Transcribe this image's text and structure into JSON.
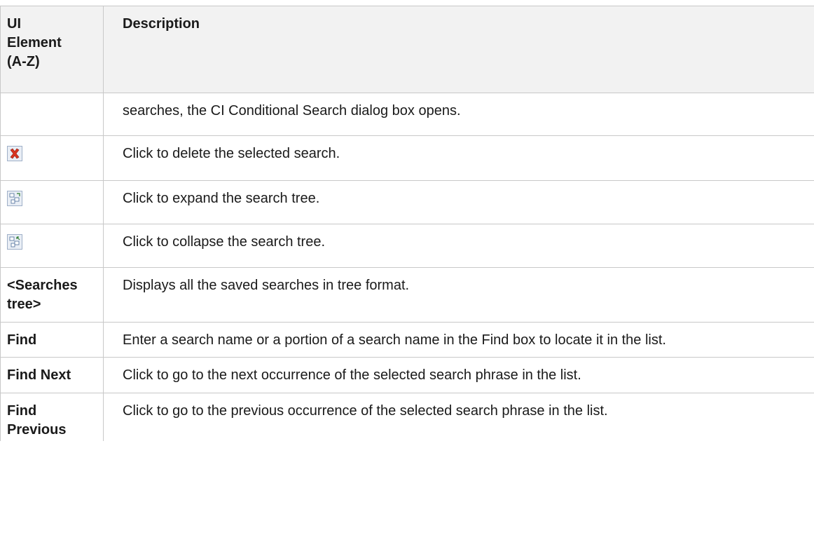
{
  "header": {
    "col1": "UI Element (A-Z)",
    "col1_lines": [
      "UI",
      "Element",
      "(A-Z)"
    ],
    "col2": "Description"
  },
  "rows": [
    {
      "element": "",
      "description": "searches, the CI Conditional Search dialog box opens."
    },
    {
      "icon": "delete-icon",
      "description": "Click to delete the selected search."
    },
    {
      "icon": "expand-tree-icon",
      "description": "Click to expand the search tree."
    },
    {
      "icon": "collapse-tree-icon",
      "description": "Click to collapse the search tree."
    },
    {
      "element_lines": [
        "<Searches",
        "tree>"
      ],
      "description": "Displays all the saved searches in tree format."
    },
    {
      "element": "Find",
      "description": "Enter a search name or a portion of a search name in the Find box to locate it in the list."
    },
    {
      "element": "Find Next",
      "description": "Click to go to the next occurrence of the selected search phrase in the list."
    },
    {
      "element_lines": [
        "Find",
        "Previous"
      ],
      "description": "Click to go to the previous occurrence of the selected search phrase in the list."
    }
  ],
  "colors": {
    "border": "#c8c8c8",
    "header_bg": "#f2f2f2",
    "delete_red": "#d9341f"
  }
}
